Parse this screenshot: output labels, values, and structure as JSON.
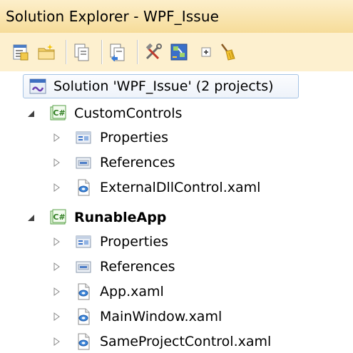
{
  "window": {
    "title": "Solution Explorer - WPF_Issue"
  },
  "toolbar": {
    "buttons": [
      {
        "name": "properties-window-icon"
      },
      {
        "name": "new-folder-icon"
      },
      {
        "name": "show-all-files-icon"
      },
      {
        "name": "refresh-icon"
      },
      {
        "name": "wrench-hammer-icon"
      },
      {
        "name": "class-diagram-icon"
      },
      {
        "name": "collapse-all-icon"
      },
      {
        "name": "broom-icon"
      }
    ]
  },
  "tree": {
    "solution": {
      "label": "Solution 'WPF_Issue' (2 projects)",
      "icon": "solution-icon"
    },
    "projects": [
      {
        "label": "CustomControls",
        "icon": "csharp-project-icon",
        "bold": false,
        "children": [
          {
            "label": "Properties",
            "icon": "properties-folder-icon"
          },
          {
            "label": "References",
            "icon": "references-folder-icon"
          },
          {
            "label": "ExternalDllControl.xaml",
            "icon": "xaml-file-icon"
          }
        ]
      },
      {
        "label": "RunableApp",
        "icon": "csharp-project-icon",
        "bold": true,
        "children": [
          {
            "label": "Properties",
            "icon": "properties-folder-icon"
          },
          {
            "label": "References",
            "icon": "references-folder-icon"
          },
          {
            "label": "App.xaml",
            "icon": "xaml-file-icon"
          },
          {
            "label": "MainWindow.xaml",
            "icon": "xaml-file-icon"
          },
          {
            "label": "SameProjectControl.xaml",
            "icon": "xaml-file-icon"
          }
        ]
      }
    ]
  }
}
